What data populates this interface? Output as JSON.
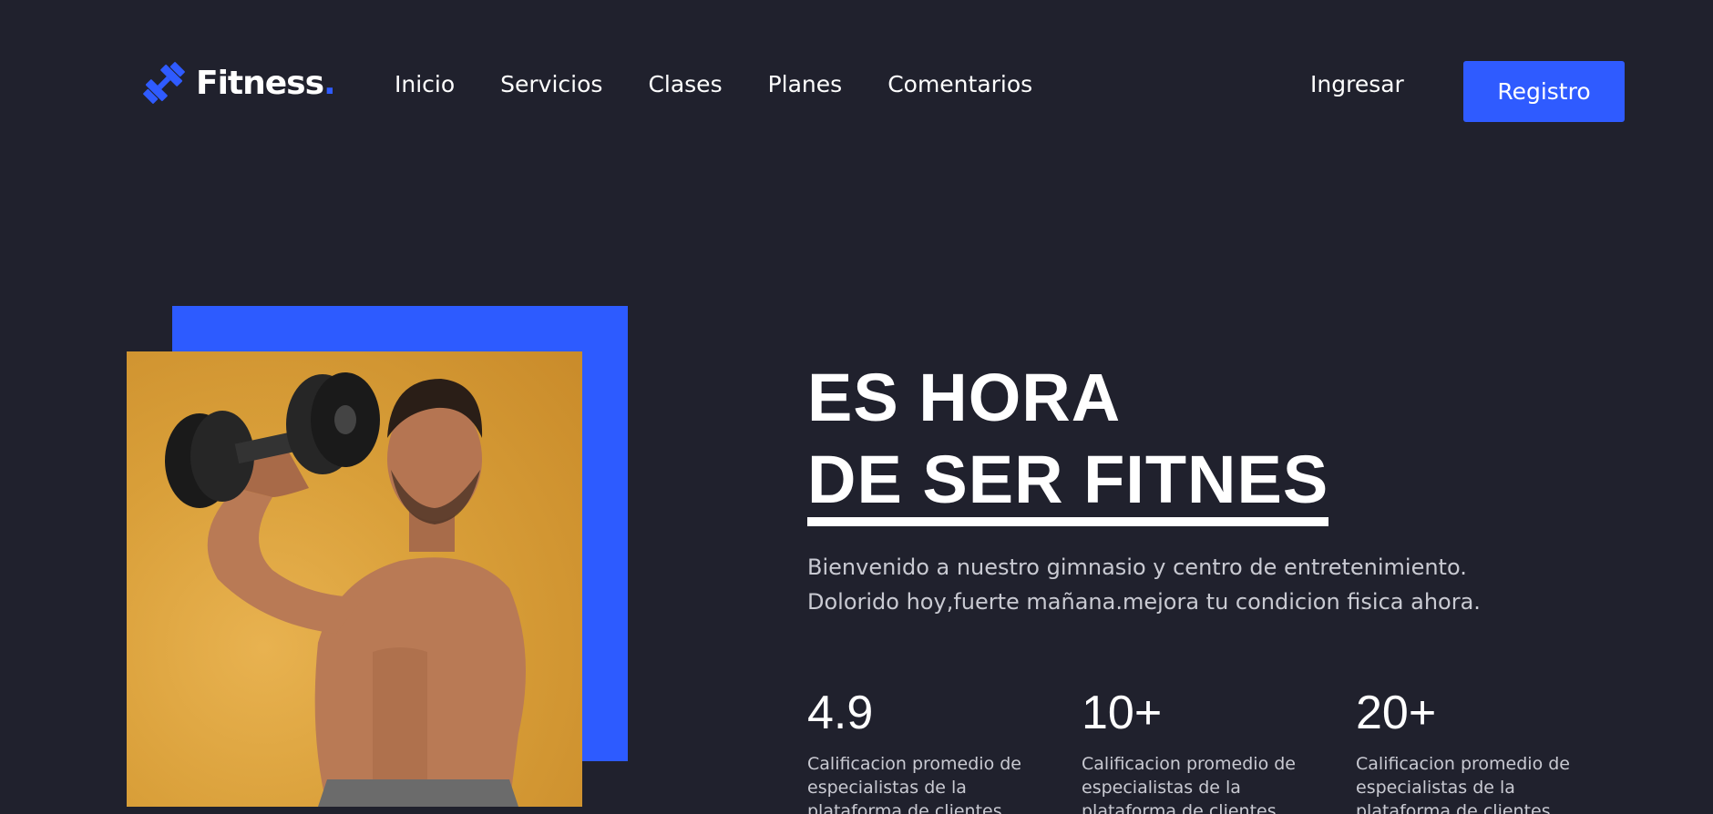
{
  "brand": {
    "name": "Fitness",
    "dot": ".",
    "accent_color": "#2f5bff",
    "logo_icon": "dumbbell-icon"
  },
  "nav": {
    "items": [
      {
        "label": "Inicio"
      },
      {
        "label": "Servicios"
      },
      {
        "label": "Clases"
      },
      {
        "label": "Planes"
      },
      {
        "label": "Comentarios"
      }
    ],
    "login_label": "Ingresar",
    "register_label": "Registro"
  },
  "hero": {
    "title_line1": "ES HORA",
    "title_line2": "DE SER FITNES",
    "subtitle_line1": "Bienvenido a nuestro gimnasio y centro de entretenimiento.",
    "subtitle_line2": "Dolorido hoy,fuerte mañana.mejora tu condicion fisica ahora.",
    "image": "man-lifting-dumbbell-photo",
    "backdrop_color": "#2d5bff",
    "photo_bg_color": "#d99f39"
  },
  "stats": [
    {
      "value": "4.9",
      "label": "Calificacion promedio de especialistas de la plataforma de clientes"
    },
    {
      "value": "10+",
      "label": "Calificacion promedio de especialistas de la plataforma de clientes"
    },
    {
      "value": "20+",
      "label": "Calificacion promedio de especialistas de la plataforma de clientes"
    }
  ]
}
